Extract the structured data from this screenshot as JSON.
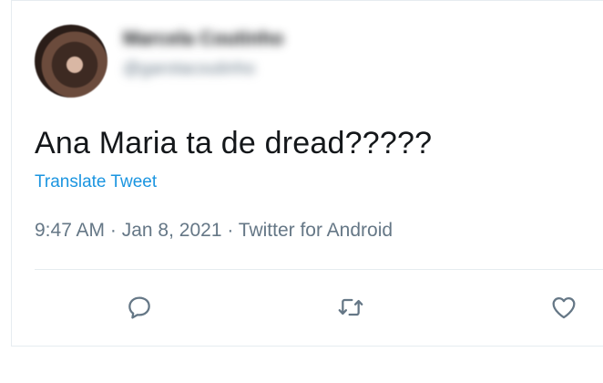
{
  "tweet": {
    "author_name": "Marcela Coutinho",
    "author_handle": "@garotacoutinho",
    "text": "Ana Maria ta de dread?????",
    "translate_label": "Translate Tweet",
    "time": "9:47 AM",
    "separator": " · ",
    "date": "Jan 8, 2021",
    "source": "Twitter for Android"
  },
  "actions": {
    "reply_icon": "reply-icon",
    "retweet_icon": "retweet-icon",
    "like_icon": "heart-icon"
  },
  "colors": {
    "text_primary": "#14171a",
    "text_secondary": "#657786",
    "link": "#1b95e0",
    "divider": "#e6ecf0"
  }
}
